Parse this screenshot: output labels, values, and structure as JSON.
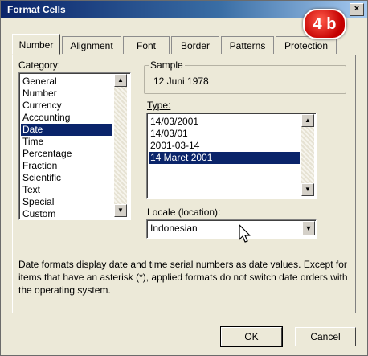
{
  "window": {
    "title": "Format Cells",
    "close_glyph": "×"
  },
  "badge": {
    "text": "4 b",
    "color": "#c40000"
  },
  "tabs": [
    {
      "label": "Number",
      "active": true
    },
    {
      "label": "Alignment",
      "active": false
    },
    {
      "label": "Font",
      "active": false
    },
    {
      "label": "Border",
      "active": false
    },
    {
      "label": "Patterns",
      "active": false
    },
    {
      "label": "Protection",
      "active": false
    }
  ],
  "category": {
    "label": "Category:",
    "items": [
      "General",
      "Number",
      "Currency",
      "Accounting",
      "Date",
      "Time",
      "Percentage",
      "Fraction",
      "Scientific",
      "Text",
      "Special",
      "Custom"
    ],
    "selected": "Date"
  },
  "sample": {
    "label": "Sample",
    "value": "12 Juni 1978"
  },
  "type": {
    "label": "Type:",
    "items": [
      "14/03/2001",
      "14/03/01",
      "2001-03-14",
      "14 Maret 2001"
    ],
    "selected": "14 Maret 2001"
  },
  "locale": {
    "label": "Locale (location):",
    "value": "Indonesian"
  },
  "description": "Date formats display date and time serial numbers as date values. Except for items that have an asterisk (*), applied formats do not switch date orders with the operating system.",
  "buttons": {
    "ok": "OK",
    "cancel": "Cancel"
  },
  "colors": {
    "selection": "#0a246a",
    "titlebar": "#0a246a",
    "dialog_bg": "#ece9d8"
  },
  "icons": {
    "scroll_up": "scroll-up-arrow-icon",
    "scroll_down": "scroll-down-arrow-icon",
    "dropdown": "dropdown-arrow-icon",
    "cursor": "mouse-pointer-icon"
  }
}
